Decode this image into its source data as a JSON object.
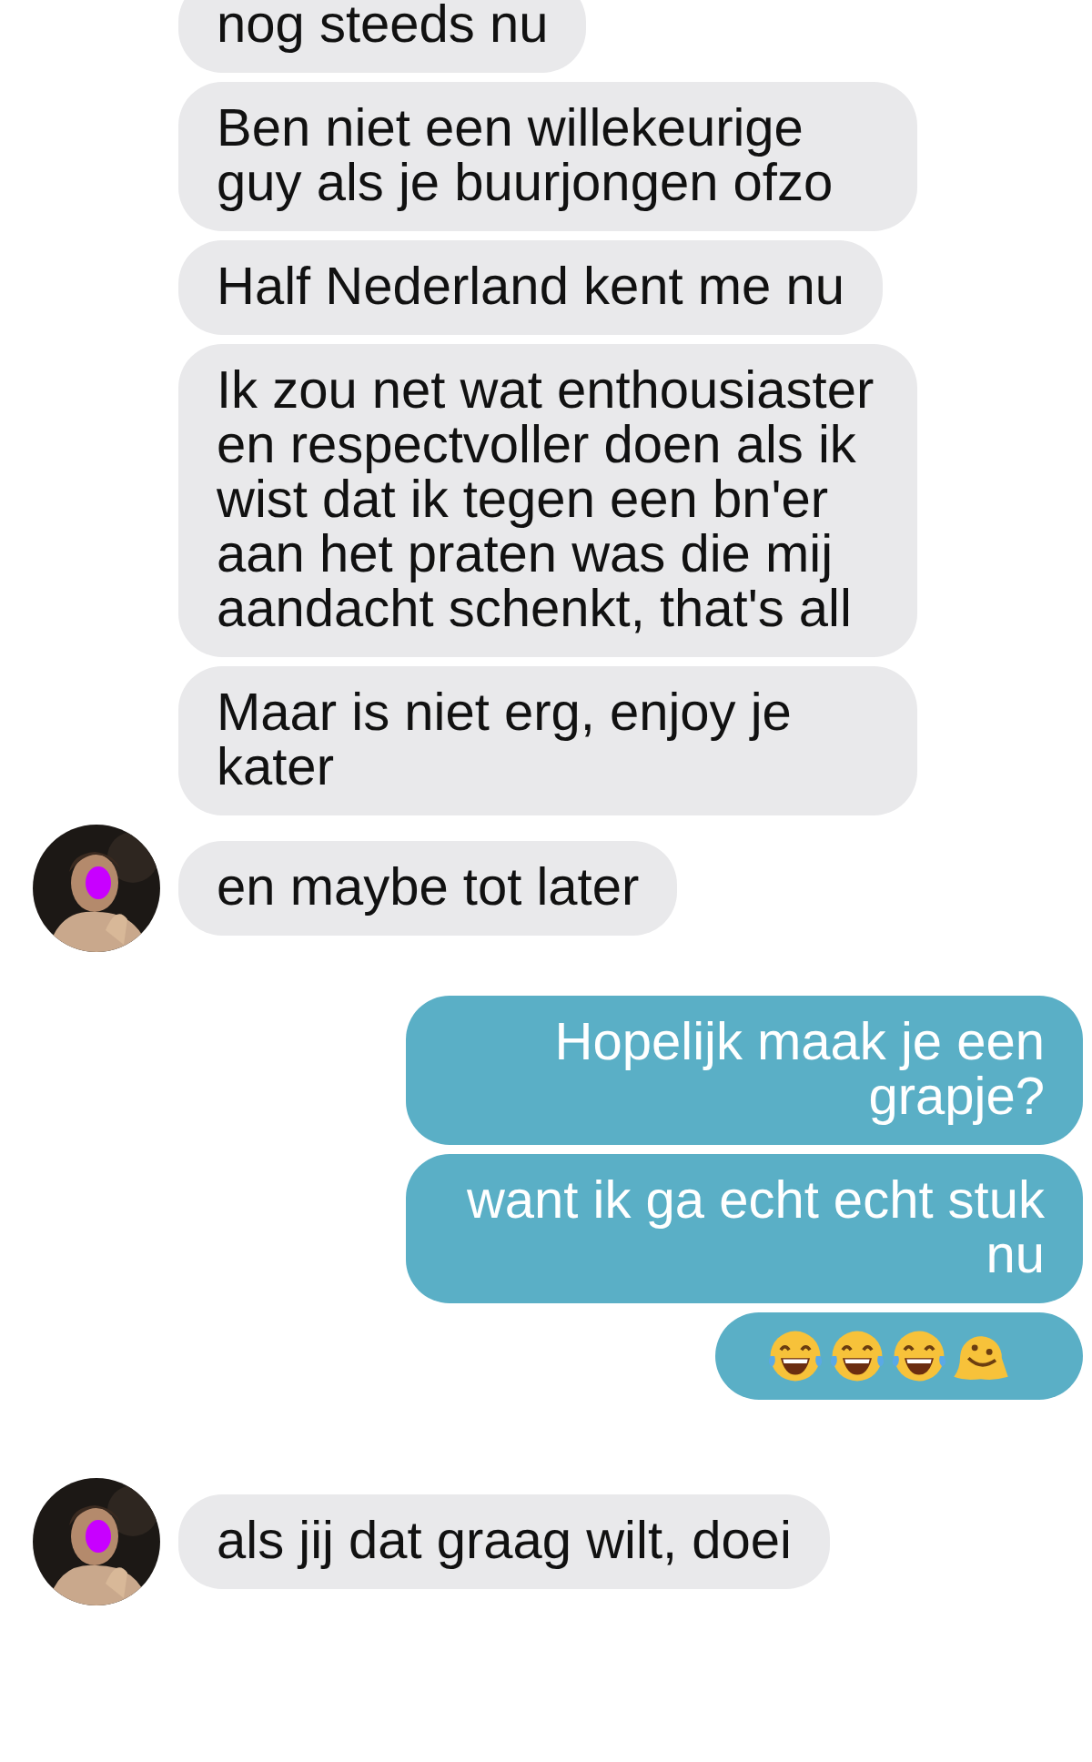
{
  "messages": [
    {
      "kind": "incoming",
      "text": "nog steeds nu",
      "avatar": false
    },
    {
      "kind": "incoming",
      "text": "Ben niet een willekeurige guy als je buurjongen ofzo",
      "avatar": false
    },
    {
      "kind": "incoming",
      "text": "Half Nederland kent me nu",
      "avatar": false
    },
    {
      "kind": "incoming",
      "text": "Ik zou net wat enthousiaster en respectvoller doen als ik wist dat ik tegen een bn'er aan het praten was die mij aandacht schenkt, that's all",
      "avatar": false
    },
    {
      "kind": "incoming",
      "text": "Maar is niet erg, enjoy je kater",
      "avatar": false
    },
    {
      "kind": "incoming",
      "text": "en maybe tot later",
      "avatar": true
    },
    {
      "kind": "outgoing",
      "text": "Hopelijk maak je een grapje?"
    },
    {
      "kind": "outgoing",
      "text": "want ik ga echt echt stuk nu"
    },
    {
      "kind": "emoji",
      "emojis": [
        {
          "kind": "laughing"
        },
        {
          "kind": "laughing"
        },
        {
          "kind": "laughing"
        },
        {
          "kind": "melting"
        }
      ]
    },
    {
      "kind": "incoming",
      "text": "als jij dat graag wilt, doei",
      "avatar": true
    }
  ]
}
